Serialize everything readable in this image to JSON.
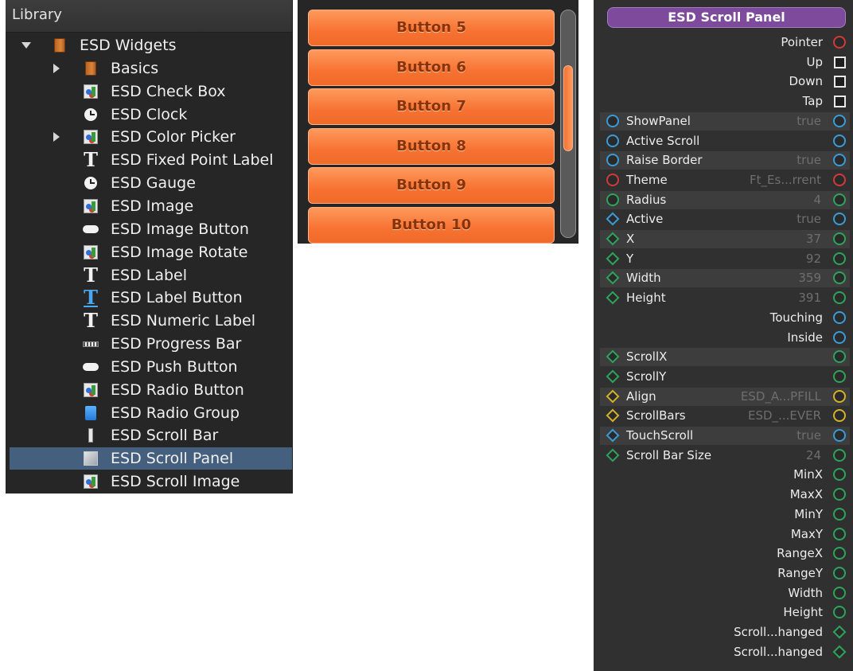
{
  "library": {
    "title": "Library",
    "items": [
      {
        "label": "ESD Widgets",
        "icon": "folder-icon",
        "depth": 0,
        "arrow": "down"
      },
      {
        "label": "Basics",
        "icon": "folder-icon",
        "depth": 1,
        "arrow": "right"
      },
      {
        "label": "ESD Check Box",
        "icon": "widget-icon",
        "depth": 1,
        "arrow": ""
      },
      {
        "label": "ESD Clock",
        "icon": "clock-icon",
        "depth": 1,
        "arrow": ""
      },
      {
        "label": "ESD Color Picker",
        "icon": "widget-icon",
        "depth": 1,
        "arrow": "right"
      },
      {
        "label": "ESD Fixed Point Label",
        "icon": "text-icon",
        "depth": 1,
        "arrow": ""
      },
      {
        "label": "ESD Gauge",
        "icon": "clock-icon",
        "depth": 1,
        "arrow": ""
      },
      {
        "label": "ESD Image",
        "icon": "widget-icon",
        "depth": 1,
        "arrow": ""
      },
      {
        "label": "ESD Image Button",
        "icon": "pill-button-icon",
        "depth": 1,
        "arrow": ""
      },
      {
        "label": "ESD Image Rotate",
        "icon": "widget-icon",
        "depth": 1,
        "arrow": ""
      },
      {
        "label": "ESD Label",
        "icon": "text-icon",
        "depth": 1,
        "arrow": ""
      },
      {
        "label": "ESD Label Button",
        "icon": "text-button-icon",
        "depth": 1,
        "arrow": ""
      },
      {
        "label": "ESD Numeric Label",
        "icon": "text-icon",
        "depth": 1,
        "arrow": ""
      },
      {
        "label": "ESD Progress Bar",
        "icon": "progress-bar-icon",
        "depth": 1,
        "arrow": ""
      },
      {
        "label": "ESD Push Button",
        "icon": "pill-button-icon",
        "depth": 1,
        "arrow": ""
      },
      {
        "label": "ESD Radio Button",
        "icon": "widget-icon",
        "depth": 1,
        "arrow": ""
      },
      {
        "label": "ESD Radio Group",
        "icon": "group-icon",
        "depth": 1,
        "arrow": ""
      },
      {
        "label": "ESD Scroll Bar",
        "icon": "scroll-bar-icon",
        "depth": 1,
        "arrow": ""
      },
      {
        "label": "ESD Scroll Panel",
        "icon": "scroll-panel-icon",
        "depth": 1,
        "arrow": "",
        "selected": true
      },
      {
        "label": "ESD Scroll Image",
        "icon": "widget-icon",
        "depth": 1,
        "arrow": ""
      }
    ]
  },
  "preview": {
    "buttons": [
      "Button 5",
      "Button 6",
      "Button 7",
      "Button 8",
      "Button 9",
      "Button 10"
    ],
    "scroll_position": 0.38,
    "accent": "#f77232"
  },
  "node": {
    "title": "ESD Scroll Panel",
    "title_color": "#7e4a9c",
    "rows": [
      {
        "side": "right",
        "name": "Pointer",
        "port": "circle",
        "color": "red",
        "band": false
      },
      {
        "side": "right",
        "name": "Up",
        "port": "checkbox",
        "color": "white",
        "band": false
      },
      {
        "side": "right",
        "name": "Down",
        "port": "checkbox",
        "color": "white",
        "band": false
      },
      {
        "side": "right",
        "name": "Tap",
        "port": "checkbox",
        "color": "white",
        "band": false
      },
      {
        "side": "left",
        "name": "ShowPanel",
        "value": "true",
        "port": "circle",
        "color": "blue",
        "band": true
      },
      {
        "side": "left",
        "name": "Active Scroll",
        "value": "",
        "port": "circle",
        "color": "blue",
        "band": false
      },
      {
        "side": "left",
        "name": "Raise Border",
        "value": "true",
        "port": "circle",
        "color": "blue",
        "band": true
      },
      {
        "side": "left",
        "name": "Theme",
        "value": "Ft_Es...rrent",
        "port": "circle",
        "color": "red",
        "band": false
      },
      {
        "side": "left",
        "name": "Radius",
        "value": "4",
        "port": "circle",
        "color": "green",
        "band": true
      },
      {
        "side": "left",
        "name": "Active",
        "value": "true",
        "port": "diamond",
        "rport": "circle",
        "color": "blue",
        "band": false
      },
      {
        "side": "left",
        "name": "X",
        "value": "37",
        "port": "diamond",
        "rport": "circle",
        "color": "green",
        "band": true
      },
      {
        "side": "left",
        "name": "Y",
        "value": "92",
        "port": "diamond",
        "rport": "circle",
        "color": "green",
        "band": false
      },
      {
        "side": "left",
        "name": "Width",
        "value": "359",
        "port": "diamond",
        "rport": "circle",
        "color": "green",
        "band": true
      },
      {
        "side": "left",
        "name": "Height",
        "value": "391",
        "port": "diamond",
        "rport": "circle",
        "color": "green",
        "band": false
      },
      {
        "side": "right",
        "name": "Touching",
        "port": "circle",
        "color": "blue",
        "band": false
      },
      {
        "side": "right",
        "name": "Inside",
        "port": "circle",
        "color": "blue",
        "band": false
      },
      {
        "side": "left",
        "name": "ScrollX",
        "value": "",
        "port": "diamond",
        "rport": "circle",
        "color": "green",
        "band": true
      },
      {
        "side": "left",
        "name": "ScrollY",
        "value": "",
        "port": "diamond",
        "rport": "circle",
        "color": "green",
        "band": false
      },
      {
        "side": "left",
        "name": "Align",
        "value": "ESD_A...PFILL",
        "port": "diamond",
        "rport": "circle",
        "color": "yellow",
        "band": true
      },
      {
        "side": "left",
        "name": "ScrollBars",
        "value": "ESD_...EVER",
        "port": "diamond",
        "rport": "circle",
        "color": "yellow",
        "band": false
      },
      {
        "side": "left",
        "name": "TouchScroll",
        "value": "true",
        "port": "diamond",
        "rport": "circle",
        "color": "blue",
        "band": true
      },
      {
        "side": "left",
        "name": "Scroll Bar Size",
        "value": "24",
        "port": "diamond",
        "rport": "circle",
        "color": "green",
        "band": false
      },
      {
        "side": "right",
        "name": "MinX",
        "port": "circle",
        "color": "green",
        "band": false
      },
      {
        "side": "right",
        "name": "MaxX",
        "port": "circle",
        "color": "green",
        "band": false
      },
      {
        "side": "right",
        "name": "MinY",
        "port": "circle",
        "color": "green",
        "band": false
      },
      {
        "side": "right",
        "name": "MaxY",
        "port": "circle",
        "color": "green",
        "band": false
      },
      {
        "side": "right",
        "name": "RangeX",
        "port": "circle",
        "color": "green",
        "band": false
      },
      {
        "side": "right",
        "name": "RangeY",
        "port": "circle",
        "color": "green",
        "band": false
      },
      {
        "side": "right",
        "name": "Width",
        "port": "circle",
        "color": "green",
        "band": false
      },
      {
        "side": "right",
        "name": "Height",
        "port": "circle",
        "color": "green",
        "band": false
      },
      {
        "side": "right",
        "name": "Scroll...hanged",
        "port": "diamond",
        "color": "green",
        "band": false
      },
      {
        "side": "right",
        "name": "Scroll...hanged",
        "port": "diamond",
        "color": "green",
        "band": false
      }
    ]
  }
}
